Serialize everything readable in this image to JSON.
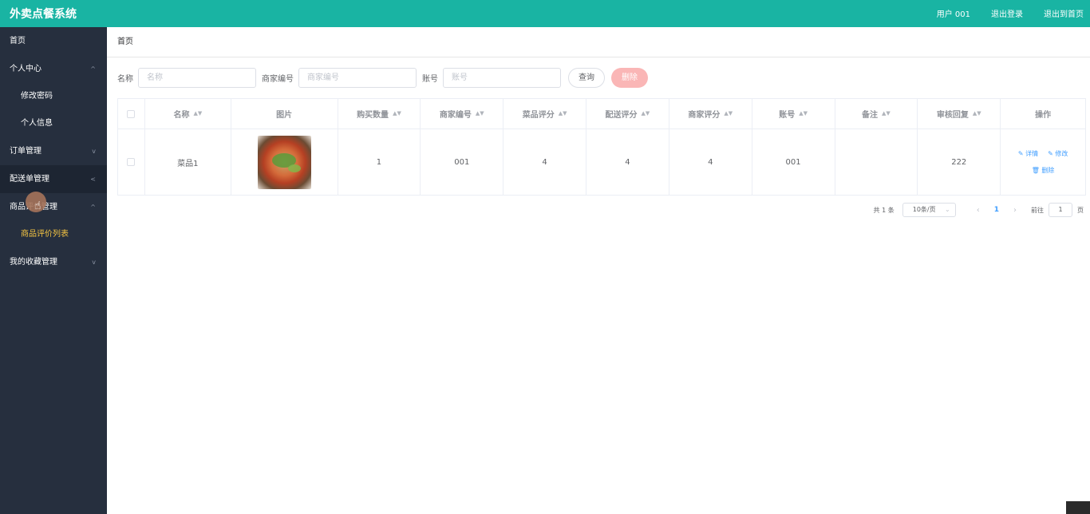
{
  "app": {
    "title": "外卖点餐系统"
  },
  "top_links": {
    "user": "用户 001",
    "logout": "退出登录",
    "exit_home": "退出到首页"
  },
  "sidebar": {
    "items": [
      {
        "label": "首页"
      },
      {
        "label": "个人中心",
        "chevron": "^"
      },
      {
        "label": "修改密码"
      },
      {
        "label": "个人信息"
      },
      {
        "label": "订单管理",
        "chevron": "v"
      },
      {
        "label": "配送单管理",
        "chevron": "<"
      },
      {
        "label": "商品评价管理",
        "chevron": "^"
      },
      {
        "label": "商品评价列表"
      },
      {
        "label": "我的收藏管理",
        "chevron": "v"
      }
    ]
  },
  "breadcrumb": {
    "home": "首页"
  },
  "filters": {
    "name_label": "名称",
    "name_placeholder": "名称",
    "merchant_label": "商家编号",
    "merchant_placeholder": "商家编号",
    "account_label": "账号",
    "account_placeholder": "账号",
    "query_label": "查询",
    "delete_label": "删除"
  },
  "table": {
    "headers": [
      "名称",
      "图片",
      "购买数量",
      "商家编号",
      "菜品评分",
      "配送评分",
      "商家评分",
      "账号",
      "备注",
      "审核回复",
      "操作"
    ],
    "rows": [
      {
        "name": "菜品1",
        "image_icon": "food-dish-image",
        "qty": "1",
        "merchant_no": "001",
        "dish_score": "4",
        "delivery_score": "4",
        "merchant_score": "4",
        "account": "001",
        "remark": "",
        "reply": "222"
      }
    ],
    "ops": {
      "detail": "详情",
      "edit": "修改",
      "delete": "删除"
    }
  },
  "pagination": {
    "total": "共 1 条",
    "page_size": "10条/页",
    "current": "1",
    "goto_prefix": "前往",
    "goto_value": "1",
    "goto_suffix": "页"
  },
  "colors": {
    "topbar": "#19b4a3",
    "sidebar": "#262f3e",
    "link": "#409eff",
    "active": "#f5c542",
    "danger_light": "#fab6b6"
  }
}
